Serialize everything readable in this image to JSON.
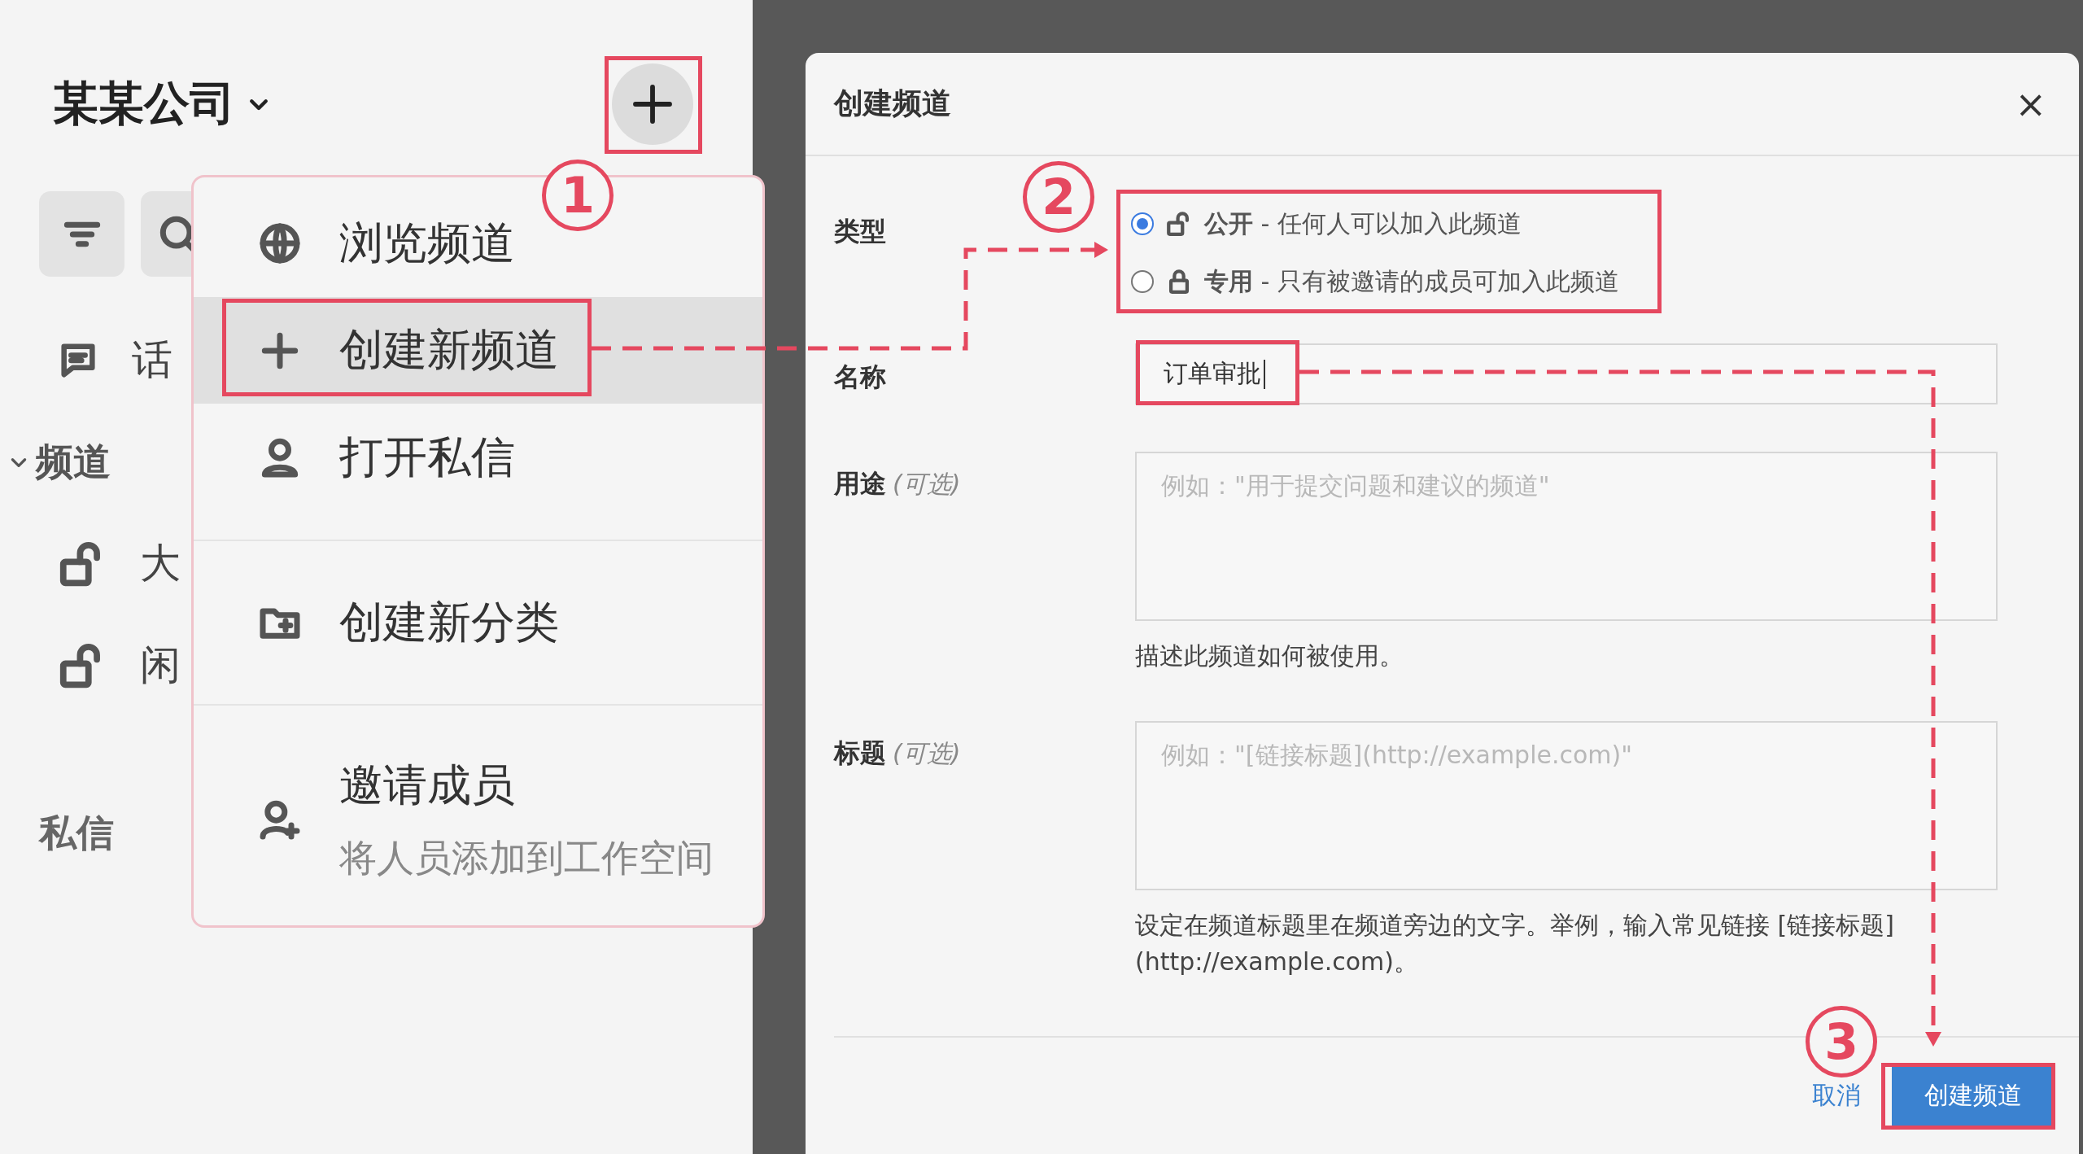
{
  "sidebar": {
    "workspace": "某某公司",
    "nav": [
      {
        "kind": "topic",
        "label": "话"
      },
      {
        "kind": "section",
        "label": "频道",
        "expanded": true
      },
      {
        "kind": "channel",
        "label": "大"
      },
      {
        "kind": "channel",
        "label": "闲"
      },
      {
        "kind": "heading",
        "label": "私信"
      }
    ]
  },
  "menu": {
    "groups": [
      [
        {
          "label": "浏览频道",
          "selected": false
        },
        {
          "label": "创建新频道",
          "selected": true
        },
        {
          "label": "打开私信",
          "selected": false
        }
      ],
      [
        {
          "label": "创建新分类",
          "selected": false
        }
      ],
      [
        {
          "label": "邀请成员",
          "subtitle": "将人员添加到工作空间",
          "selected": false
        }
      ]
    ]
  },
  "dialog": {
    "title": "创建频道",
    "close": "×",
    "type_label": "类型",
    "types": [
      {
        "name": "公开",
        "description": " - 任何人可以加入此频道",
        "selected": true
      },
      {
        "name": "专用",
        "description": " - 只有被邀请的成员可加入此频道",
        "selected": false
      }
    ],
    "name": {
      "label": "名称",
      "value": "订单审批"
    },
    "purpose": {
      "label": "用途",
      "optional": "(可选)",
      "placeholder": "例如：\"用于提交问题和建议的频道\"",
      "help": "描述此频道如何被使用。"
    },
    "header": {
      "label": "标题",
      "optional": "(可选)",
      "placeholder": "例如：\"[链接标题](http://example.com)\"",
      "help": "设定在频道标题里在频道旁边的文字。举例，输入常见链接 [链接标题](http://example.com)。"
    },
    "buttons": [
      {
        "kind": "link",
        "label": "取消"
      },
      {
        "kind": "primary",
        "label": "创建频道"
      }
    ]
  },
  "steps": [
    {
      "number": "1"
    },
    {
      "number": "2"
    },
    {
      "number": "3"
    }
  ]
}
